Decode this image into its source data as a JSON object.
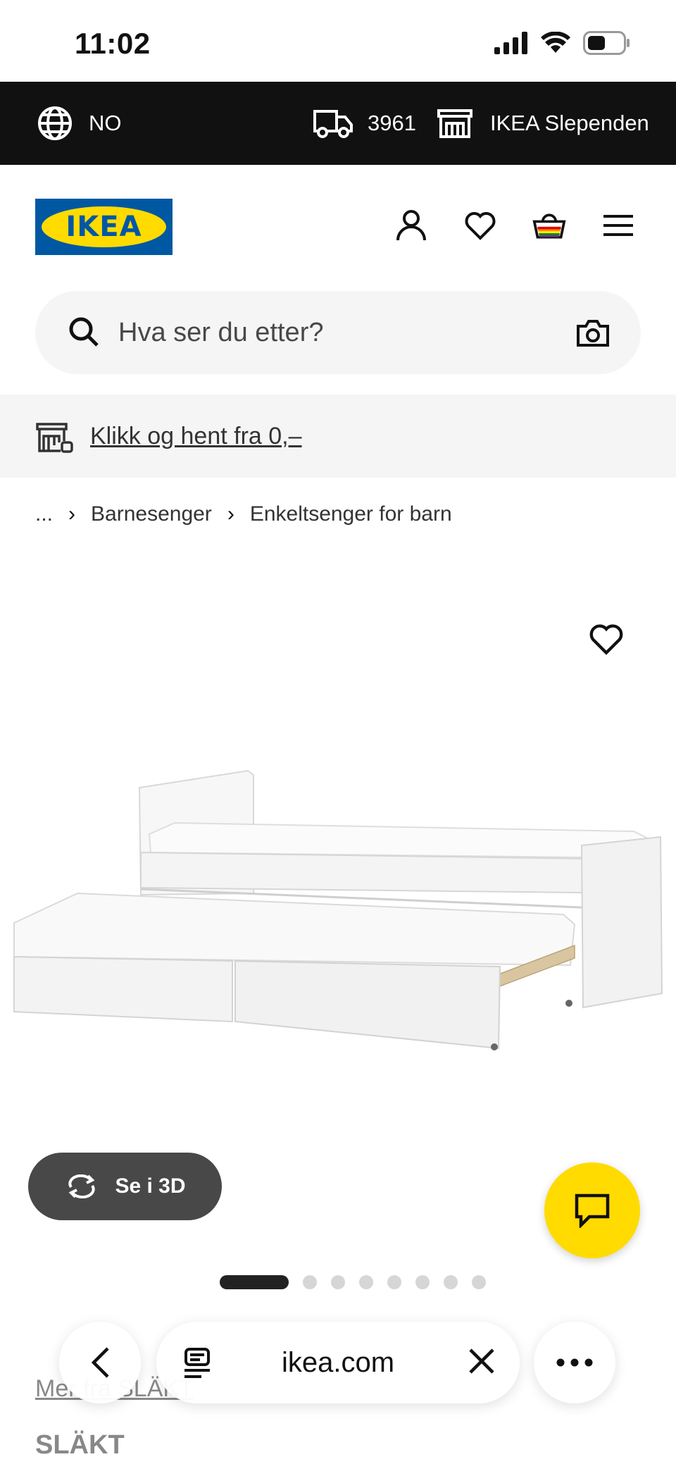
{
  "status_bar": {
    "time": "11:02"
  },
  "top_bar": {
    "language": "NO",
    "postal_code": "3961",
    "store": "IKEA Slependen"
  },
  "header": {
    "logo_text": "IKEA"
  },
  "search": {
    "placeholder": "Hva ser du etter?"
  },
  "promo": {
    "text": "Klikk og hent fra 0,–"
  },
  "breadcrumb": {
    "ellipsis": "...",
    "items": [
      "Barnesenger",
      "Enkeltsenger for barn"
    ]
  },
  "product": {
    "view_3d_label": "Se i 3D",
    "image_count": 8,
    "active_image": 1,
    "below_link": "Mer fra SLÄKT",
    "below_title": "SLÄKT"
  },
  "browser": {
    "url": "ikea.com"
  },
  "colors": {
    "brand_blue": "#0058a3",
    "brand_yellow": "#ffdb00",
    "top_bar": "#111111"
  }
}
